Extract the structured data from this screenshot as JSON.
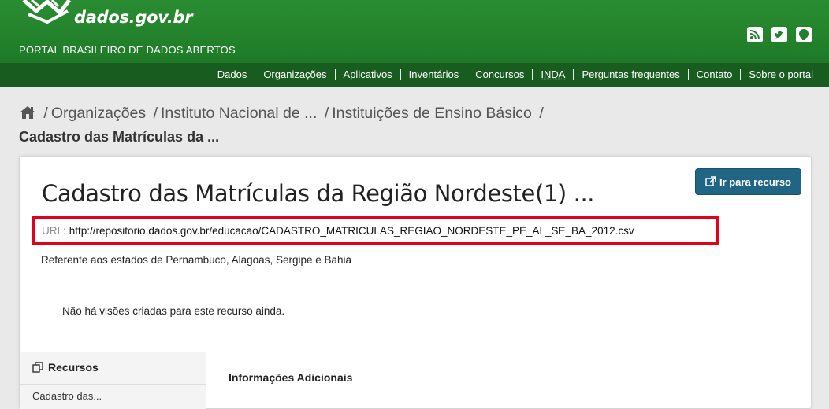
{
  "header": {
    "site_name": "dados.gov.br",
    "tagline": "PORTAL BRASILEIRO DE DADOS ABERTOS",
    "social_icons": [
      "rss-icon",
      "twitter-icon",
      "github-icon"
    ]
  },
  "nav": {
    "items": [
      {
        "label": "Dados"
      },
      {
        "label": "Organizações"
      },
      {
        "label": "Aplicativos"
      },
      {
        "label": "Inventários"
      },
      {
        "label": "Concursos"
      },
      {
        "label": "INDA"
      },
      {
        "label": "Perguntas frequentes"
      },
      {
        "label": "Contato"
      },
      {
        "label": "Sobre o portal"
      }
    ]
  },
  "breadcrumb": {
    "home_icon": "home-icon",
    "separator": "/",
    "items": [
      "Organizações",
      "Instituto Nacional de ...",
      "Instituições de Ensino Básico"
    ],
    "current": "Cadastro das Matrículas da ..."
  },
  "resource": {
    "go_button": "Ir para recurso",
    "title": "Cadastro das Matrículas da Região Nordeste(1) ...",
    "url_label": "URL:",
    "url": "http://repositorio.dados.gov.br/educacao/CADASTRO_MATRICULAS_REGIAO_NORDESTE_PE_AL_SE_BA_2012.csv",
    "description": "Referente aos estados de Pernambuco, Alagoas, Sergipe e Bahia",
    "no_views": "Não há visões criadas para este recurso ainda."
  },
  "sidebar": {
    "heading": "Recursos",
    "first_item": "Cadastro das..."
  },
  "info": {
    "heading": "Informações Adicionais"
  },
  "colors": {
    "header_green": "#22802c",
    "nav_green": "#185c1f",
    "button_blue": "#216585",
    "highlight_red": "#e3001b"
  }
}
